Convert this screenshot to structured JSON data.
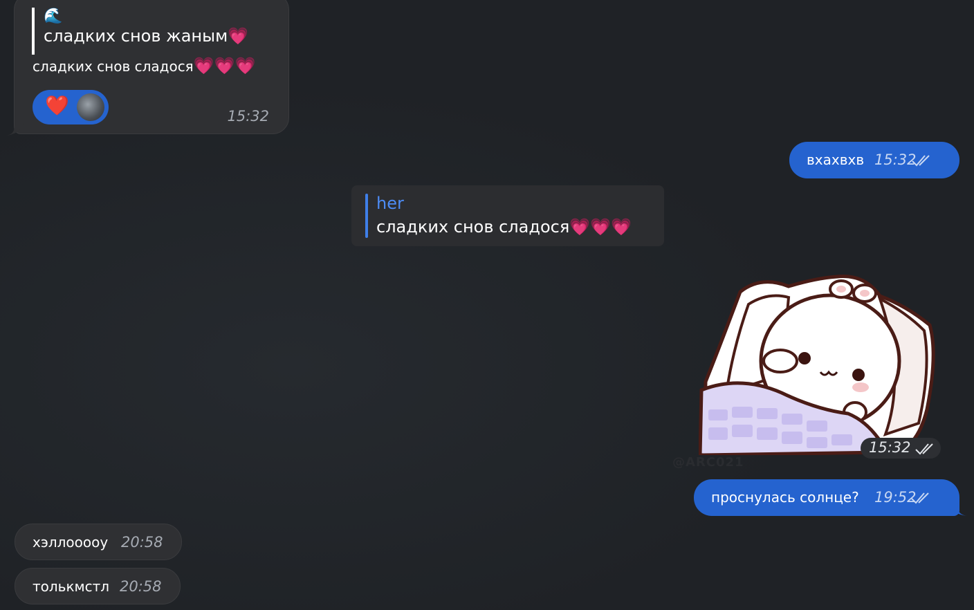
{
  "messages": {
    "m1": {
      "quote_icon": "🌊",
      "quote_text": "сладких снов жаным",
      "body": "сладких снов сладося",
      "reaction_icon": "heart-icon",
      "time": "15:32"
    },
    "m2": {
      "text": "вхахвхв",
      "time": "15:32"
    },
    "reply_card": {
      "author": "her",
      "text": "сладких снов сладося"
    },
    "sticker": {
      "time": "15:32",
      "watermark": "@ARC021"
    },
    "m3": {
      "text": "проснулась солнце?",
      "time": "19:52"
    },
    "m4": {
      "text": "хэллоoooу",
      "time": "20:58"
    },
    "m5": {
      "text": "толькмстл",
      "time": "20:58"
    }
  },
  "colors": {
    "background": "#1f2226",
    "incoming_bubble": "#2f3033",
    "outgoing_bubble": "#2563cf",
    "reply_accent": "#4d8cf5",
    "heart_pink": "#ff5aa8"
  }
}
